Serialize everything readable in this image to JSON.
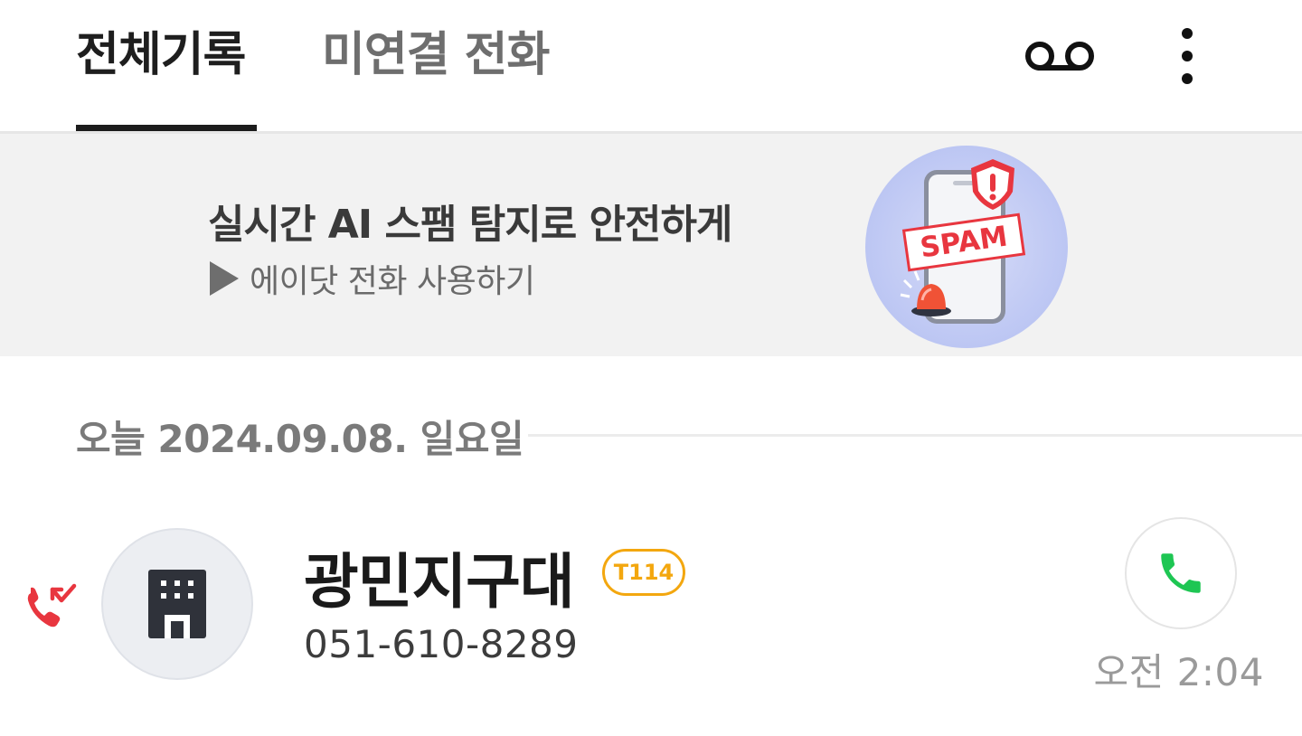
{
  "tabs": {
    "all_label": "전체기록",
    "missed_label": "미연결 전화"
  },
  "toolbar": {
    "voicemail_icon": "voicemail-icon",
    "more_icon": "more-vert-icon"
  },
  "banner": {
    "title": "실시간 AI 스팸 탐지로 안전하게",
    "subtitle": "에이닷 전화 사용하기",
    "art_text": "SPAM"
  },
  "date_section": {
    "label": "오늘 2024.09.08. 일요일"
  },
  "calls": [
    {
      "name": "광민지구대",
      "badge": "T114",
      "number": "051-610-8289",
      "time": "오전 2:04",
      "type": "missed",
      "avatar_icon": "building-icon"
    }
  ],
  "colors": {
    "accent_text": "#1e1e1e",
    "missed_red": "#e8363f",
    "call_green": "#1ec653",
    "badge_orange": "#f3a70f",
    "banner_bg": "#f2f2f2"
  }
}
